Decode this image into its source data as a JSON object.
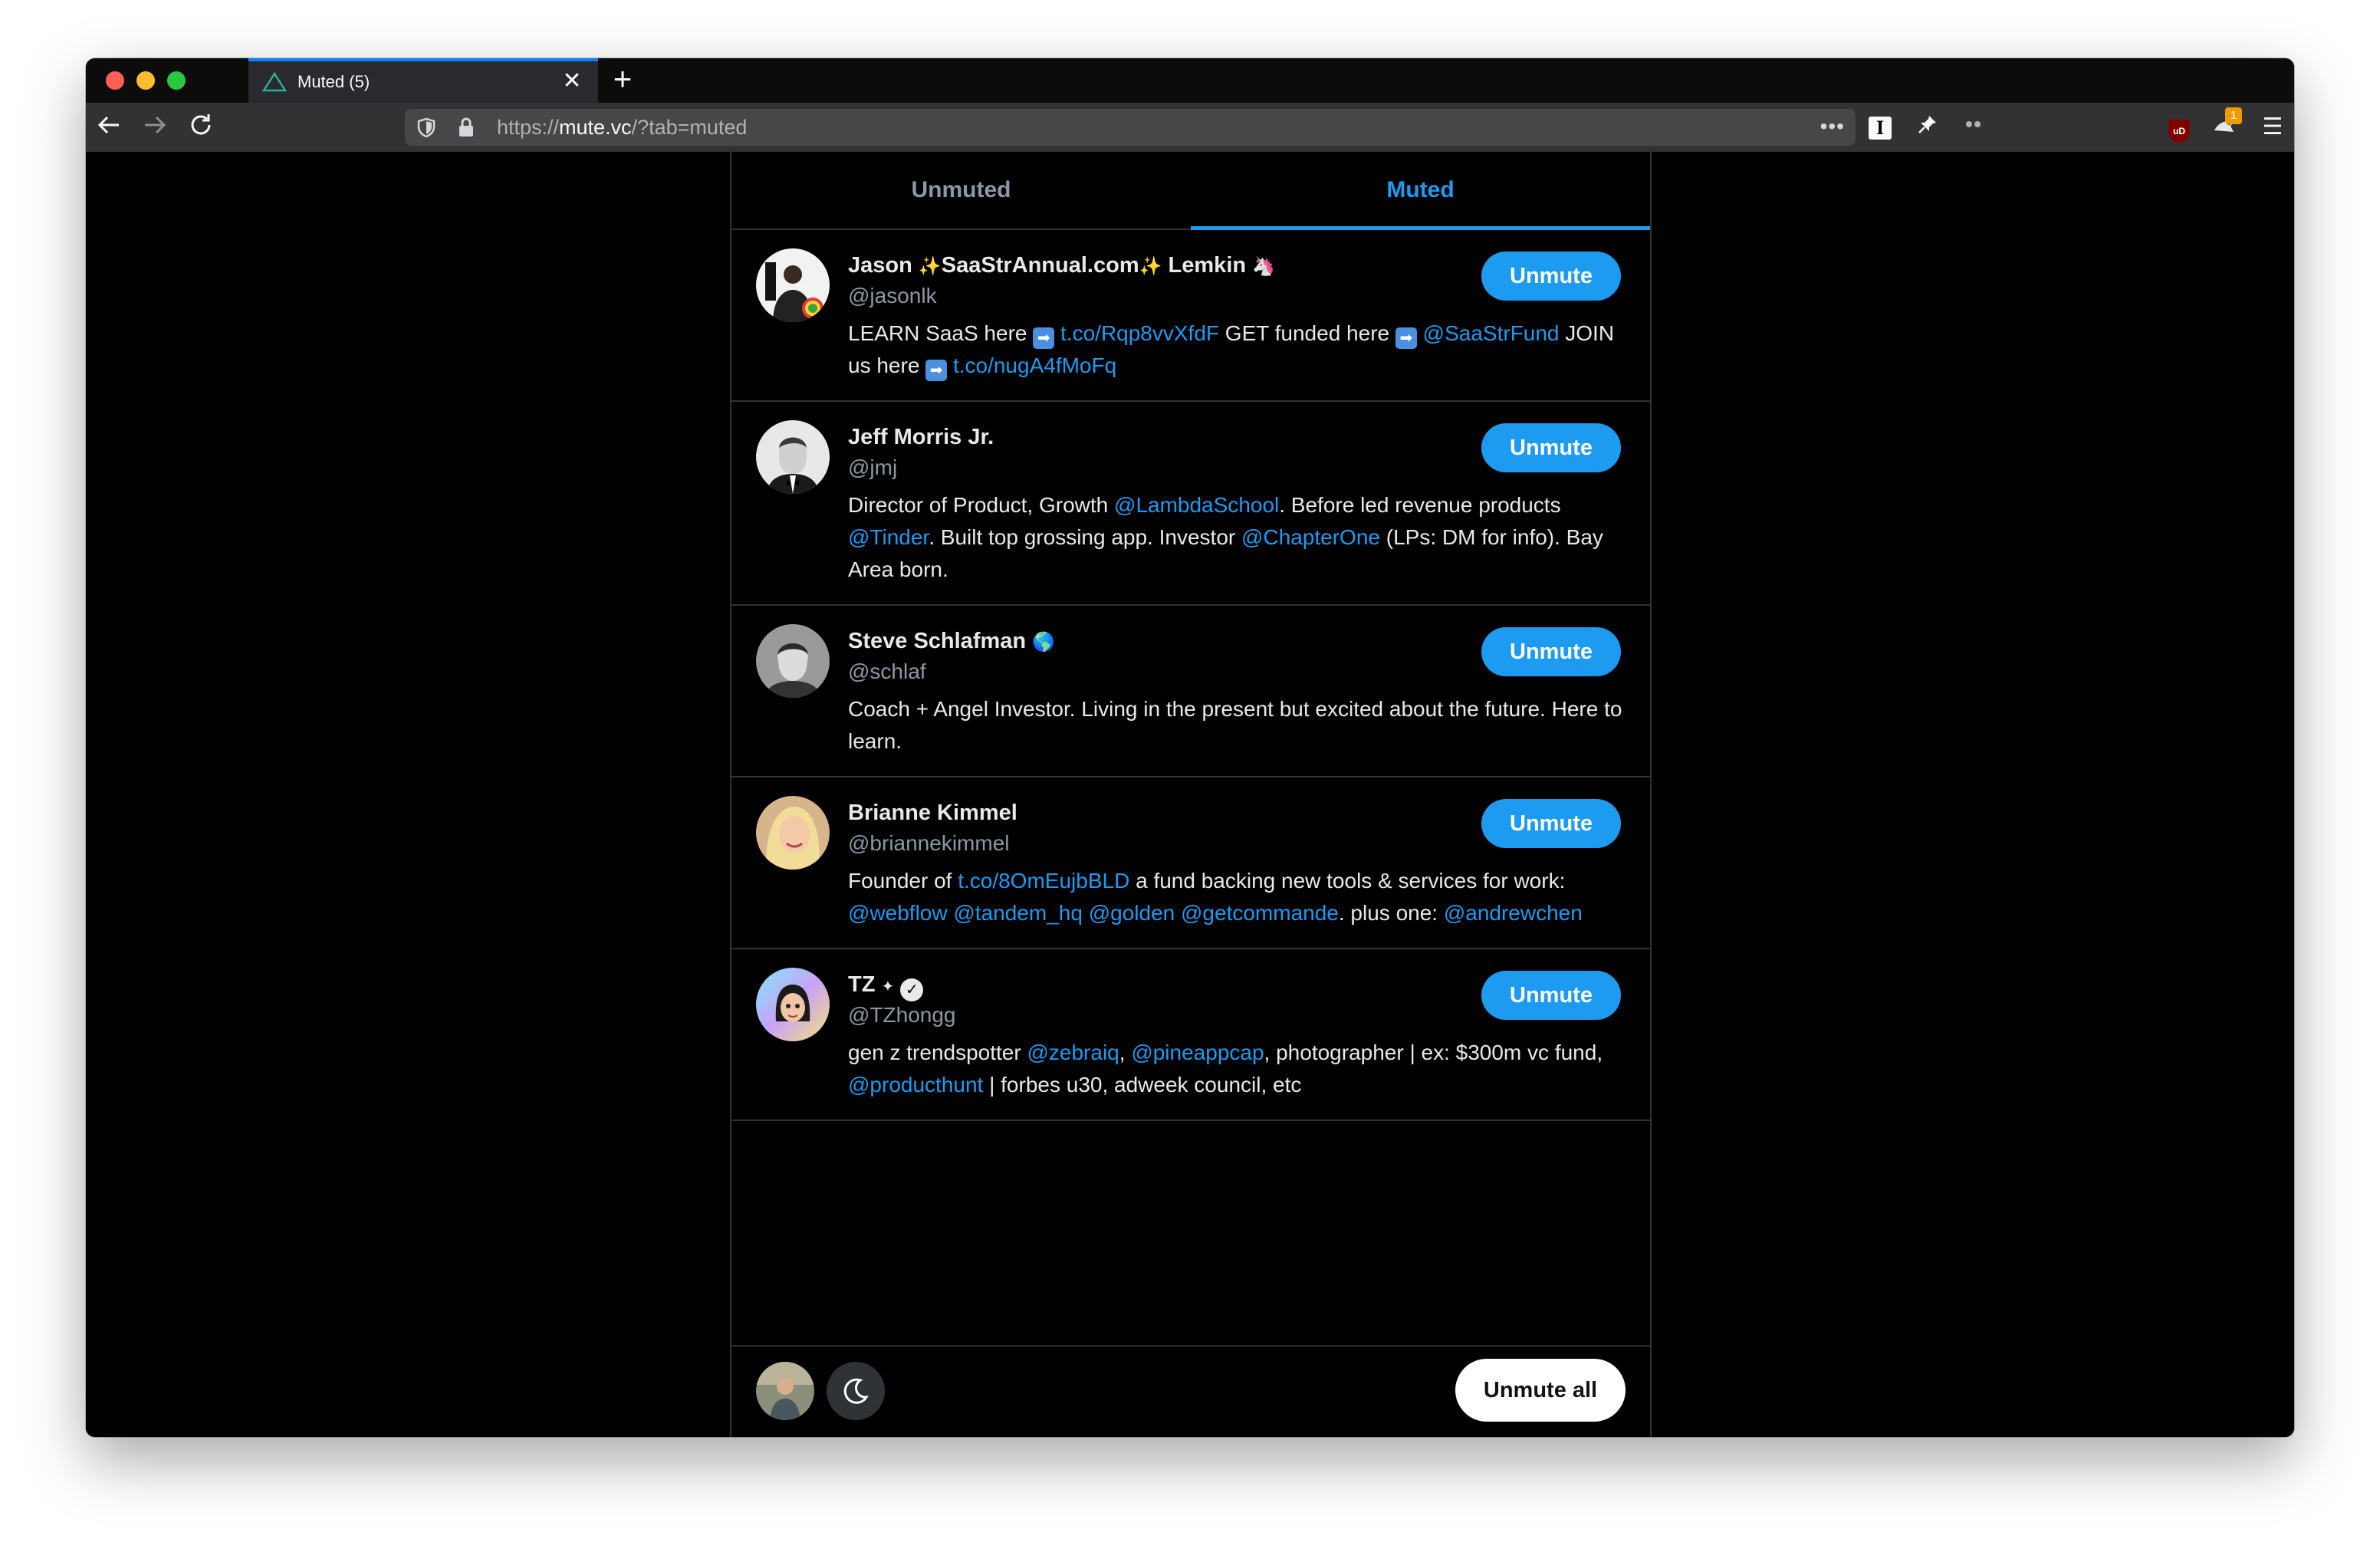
{
  "browser": {
    "tab_title": "Muted (5)",
    "tab_close": "✕",
    "new_tab": "+",
    "url_scheme": "https://",
    "url_host": "mute.vc",
    "url_path": "/?tab=muted",
    "url_more": "•••",
    "reader_icon_label": "I",
    "ublock_label": "uD",
    "extension_badge_count": "1",
    "menu_glyph": "☰"
  },
  "tabs": {
    "unmuted_label": "Unmuted",
    "muted_label": "Muted"
  },
  "users": [
    {
      "name_parts": [
        "Jason ",
        "✨",
        "SaaStrAnnual.com",
        "✨",
        " Lemkin ",
        "🦄"
      ],
      "handle": "@jasonlk",
      "bio": [
        {
          "t": "LEARN SaaS here ",
          "link": false
        },
        {
          "t": "➡",
          "arrow": true
        },
        {
          "t": " ",
          "link": false
        },
        {
          "t": "t.co/Rqp8vvXfdF",
          "link": true
        },
        {
          "t": " GET funded here ",
          "link": false
        },
        {
          "t": "➡",
          "arrow": true
        },
        {
          "t": " ",
          "link": false
        },
        {
          "t": "@SaaStrFund",
          "link": true
        },
        {
          "t": " JOIN us here ",
          "link": false
        },
        {
          "t": "➡",
          "arrow": true
        },
        {
          "t": " ",
          "link": false
        },
        {
          "t": "t.co/nugA4fMoFq",
          "link": true
        }
      ],
      "button": "Unmute"
    },
    {
      "name_parts": [
        "Jeff Morris Jr."
      ],
      "handle": "@jmj",
      "bio": [
        {
          "t": "Director of Product, Growth ",
          "link": false
        },
        {
          "t": "@LambdaSchool",
          "link": true
        },
        {
          "t": ". Before led revenue products ",
          "link": false
        },
        {
          "t": "@Tinder",
          "link": true
        },
        {
          "t": ". Built top grossing app. Investor ",
          "link": false
        },
        {
          "t": "@ChapterOne",
          "link": true
        },
        {
          "t": " (LPs: DM for info). Bay Area born.",
          "link": false
        }
      ],
      "button": "Unmute"
    },
    {
      "name_parts": [
        "Steve Schlafman ",
        "🌎"
      ],
      "handle": "@schlaf",
      "bio": [
        {
          "t": "Coach + Angel Investor. Living in the present but excited about the future. Here to learn.",
          "link": false
        }
      ],
      "button": "Unmute"
    },
    {
      "name_parts": [
        "Brianne Kimmel"
      ],
      "handle": "@briannekimmel",
      "bio": [
        {
          "t": "Founder of ",
          "link": false
        },
        {
          "t": "t.co/8OmEujbBLD",
          "link": true
        },
        {
          "t": " a fund backing new tools & services for work: ",
          "link": false
        },
        {
          "t": "@webflow",
          "link": true
        },
        {
          "t": " ",
          "link": false
        },
        {
          "t": "@tandem_hq",
          "link": true
        },
        {
          "t": " ",
          "link": false
        },
        {
          "t": "@golden",
          "link": true
        },
        {
          "t": " ",
          "link": false
        },
        {
          "t": "@getcommande",
          "link": true
        },
        {
          "t": ". plus one: ",
          "link": false
        },
        {
          "t": "@andrewchen",
          "link": true
        }
      ],
      "button": "Unmute"
    },
    {
      "name_parts": [
        "TZ ",
        "✦",
        " "
      ],
      "verified": "✓",
      "handle": "@TZhongg",
      "bio": [
        {
          "t": "gen z trendspotter ",
          "link": false
        },
        {
          "t": "@zebraiq",
          "link": true
        },
        {
          "t": ", ",
          "link": false
        },
        {
          "t": "@pineappcap",
          "link": true
        },
        {
          "t": ", photographer | ex: $300m vc fund, ",
          "link": false
        },
        {
          "t": "@producthunt",
          "link": true
        },
        {
          "t": " | forbes u30, adweek council, etc",
          "link": false
        }
      ],
      "button": "Unmute"
    }
  ],
  "footer": {
    "unmute_all_label": "Unmute all"
  },
  "colors": {
    "accent": "#1d9bf0",
    "background": "#000000",
    "border": "#2f3336",
    "text": "#e7e9ea",
    "muted_text": "#8b98a5"
  }
}
